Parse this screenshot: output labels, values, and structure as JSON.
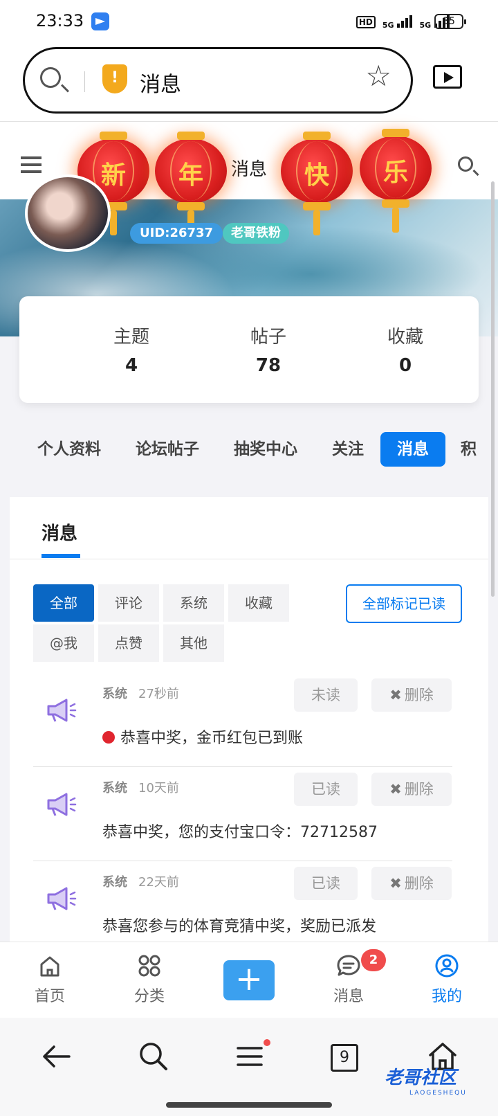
{
  "status_bar": {
    "time": "23:33",
    "network1": "5G",
    "network2": "5G",
    "hd": "HD",
    "battery": "35"
  },
  "browser": {
    "url_text": "消息"
  },
  "page_nav": {
    "title": "消息"
  },
  "lanterns": [
    "新",
    "年",
    "快",
    "乐"
  ],
  "profile": {
    "uid": "UID:26737",
    "level": "老哥铁粉"
  },
  "stats": [
    {
      "label": "主题",
      "value": "4"
    },
    {
      "label": "帖子",
      "value": "78"
    },
    {
      "label": "收藏",
      "value": "0"
    }
  ],
  "tabs": [
    "个人资料",
    "论坛帖子",
    "抽奖中心",
    "关注",
    "消息",
    "积"
  ],
  "messages_panel": {
    "title": "消息",
    "filters": [
      "全部",
      "评论",
      "系统",
      "收藏",
      "@我",
      "点赞",
      "其他"
    ],
    "mark_all_read": "全部标记已读",
    "items": [
      {
        "type": "系统",
        "time": "27秒前",
        "state": "未读",
        "delete": "删除",
        "text": "恭喜中奖，金币红包已到账",
        "unread": true
      },
      {
        "type": "系统",
        "time": "10天前",
        "state": "已读",
        "delete": "删除",
        "text": "恭喜中奖，您的支付宝口令：72712587",
        "unread": false
      },
      {
        "type": "系统",
        "time": "22天前",
        "state": "已读",
        "delete": "删除",
        "text": "恭喜您参与的体育竞猜中奖，奖励已派发",
        "unread": false
      }
    ]
  },
  "app_tabbar": {
    "items": [
      "首页",
      "分类",
      "消息",
      "我的"
    ],
    "message_badge": "2"
  },
  "system_nav": {
    "tabs_count": "9"
  },
  "watermark": {
    "text": "老哥社区",
    "sub": "LAOGESHEQU"
  },
  "colors": {
    "accent": "#0a7cf0",
    "unread_dot": "#e0252e",
    "badge": "#f04c4c",
    "lantern": "#d81e1e"
  }
}
